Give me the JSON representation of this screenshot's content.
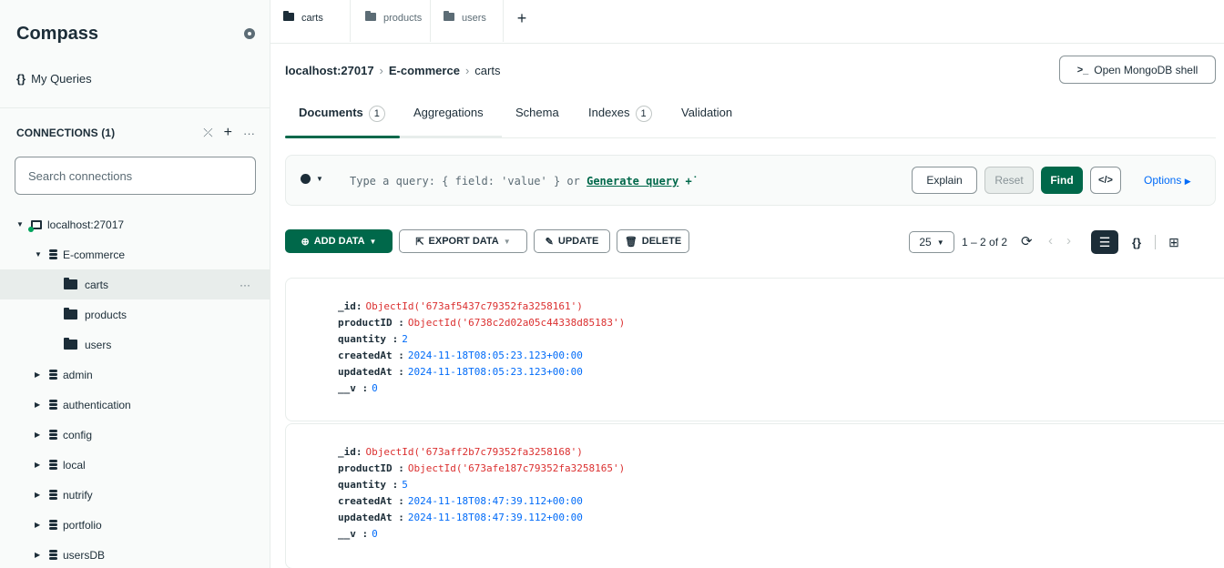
{
  "sidebar": {
    "title": "Compass",
    "my_queries": "My Queries",
    "connections_label": "CONNECTIONS (1)",
    "search_placeholder": "Search connections",
    "host": "localhost:27017",
    "databases": {
      "ecommerce": "E-commerce",
      "collections": [
        "carts",
        "products",
        "users"
      ],
      "others": [
        "admin",
        "authentication",
        "config",
        "local",
        "nutrify",
        "portfolio",
        "usersDB"
      ]
    }
  },
  "tabs": [
    "carts",
    "products",
    "users"
  ],
  "breadcrumb": {
    "host": "localhost:27017",
    "db": "E-commerce",
    "collection": "carts"
  },
  "shell_button": "Open MongoDB shell",
  "subtabs": {
    "documents": "Documents",
    "documents_count": "1",
    "aggregations": "Aggregations",
    "schema": "Schema",
    "indexes": "Indexes",
    "indexes_count": "1",
    "validation": "Validation"
  },
  "query": {
    "placeholder": "Type a query: { field: 'value' } or",
    "generate": "Generate query",
    "explain": "Explain",
    "reset": "Reset",
    "find": "Find",
    "options": "Options"
  },
  "toolbar": {
    "add_data": "ADD DATA",
    "export_data": "EXPORT DATA",
    "update": "UPDATE",
    "delete": "DELETE",
    "per_page": "25",
    "range": "1 – 2 of 2"
  },
  "documents": [
    {
      "id": "ObjectId('673af5437c79352fa3258161')",
      "productID": "ObjectId('6738c2d02a05c44338d85183')",
      "quantity": "2",
      "createdAt": "2024-11-18T08:05:23.123+00:00",
      "updatedAt": "2024-11-18T08:05:23.123+00:00",
      "v": "0"
    },
    {
      "id": "ObjectId('673aff2b7c79352fa3258168')",
      "productID": "ObjectId('673afe187c79352fa3258165')",
      "quantity": "5",
      "createdAt": "2024-11-18T08:47:39.112+00:00",
      "updatedAt": "2024-11-18T08:47:39.112+00:00",
      "v": "0"
    }
  ],
  "keys": {
    "id": "_id:",
    "productID": "productID :",
    "quantity": "quantity :",
    "createdAt": "createdAt :",
    "updatedAt": "updatedAt :",
    "v": "__v :"
  },
  "colors": {
    "accent": "#00684a",
    "oid": "#db3030",
    "value": "#016bf8"
  }
}
